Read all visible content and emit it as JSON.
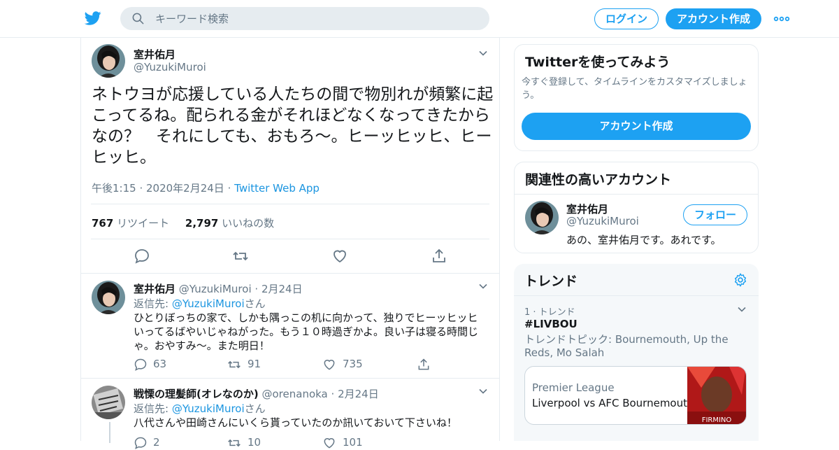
{
  "header": {
    "search_placeholder": "キーワード検索",
    "login_label": "ログイン",
    "signup_label": "アカウント作成"
  },
  "tweet": {
    "author_name": "室井佑月",
    "author_handle": "@YuzukiMuroi",
    "text": "ネトウヨが応援している人たちの間で物別れが頻繁に起こってるね。配られる金がそれほどなくなってきたからなの？　それにしても、おもろ〜。ヒーッヒッヒ、ヒーヒッヒ。",
    "time": "午後1:15 · 2020年2月24日",
    "separator": "·",
    "source": "Twitter Web App",
    "retweets_count": "767",
    "retweets_label": "リツイート",
    "likes_count": "2,797",
    "likes_label": "いいねの数"
  },
  "replies": [
    {
      "author_name": "室井佑月",
      "author_handle": "@YuzukiMuroi",
      "date": "· 2月24日",
      "reply_prefix": "返信先: ",
      "reply_to": "@YuzukiMuroi",
      "reply_suffix": "さん",
      "text": "ひとりぼっちの家で、しかも隅っこの机に向かって、独りでヒーッヒッヒいってるばやいじゃねがった。もう１０時過ぎかよ。良い子は寝る時間じゃ。おやすみ〜。また明日！",
      "reply_count": "63",
      "retweet_count": "91",
      "like_count": "735"
    },
    {
      "author_name": "戦慄の理髪師(オレなのか)",
      "author_handle": "@orenanoka",
      "date": "· 2月24日",
      "reply_prefix": "返信先: ",
      "reply_to": "@YuzukiMuroi",
      "reply_suffix": "さん",
      "text": "八代さんや田崎さんにいくら貰っていたのか訊いておいて下さいね！",
      "reply_count": "2",
      "retweet_count": "10",
      "like_count": "101"
    }
  ],
  "sidebar": {
    "signup_card": {
      "title": "Twitterを使ってみよう",
      "subtitle": "今すぐ登録して、タイムラインをカスタマイズしましょう。",
      "button": "アカウント作成"
    },
    "related": {
      "title": "関連性の高いアカウント",
      "name": "室井佑月",
      "handle": "@YuzukiMuroi",
      "bio": "あの、室井佑月です。あれです。",
      "follow_label": "フォロー"
    },
    "trends": {
      "title": "トレンド",
      "rank": "1 · トレンド",
      "hashtag": "#LIVBOU",
      "topic": "トレンドトピック: Bournemouth, Up the Reds, Mo Salah",
      "news_source": "Premier League",
      "news_title": "Liverpool vs AFC Bournemouth",
      "thumb_text": "FIRMINO"
    }
  },
  "colors": {
    "accent": "#1da1f2",
    "link": "#1b95e0",
    "muted": "#657786",
    "border": "#e6ecf0"
  }
}
